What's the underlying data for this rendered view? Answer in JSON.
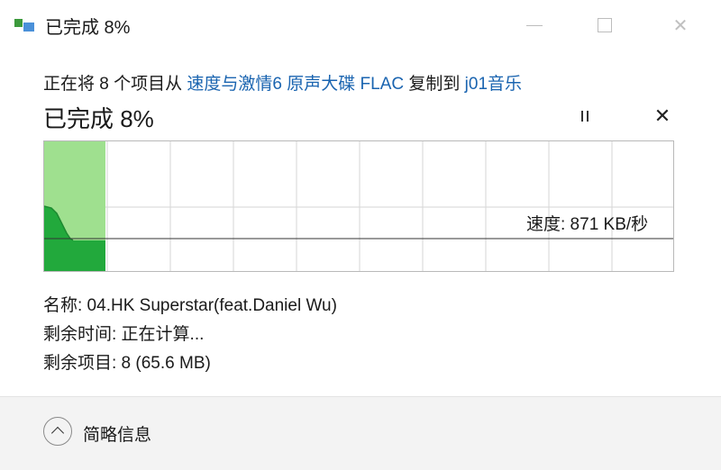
{
  "window": {
    "title": "已完成 8%"
  },
  "copy": {
    "prefix": "正在将 8 个项目从 ",
    "source": "速度与激情6 原声大碟 FLAC",
    "middle": " 复制到 ",
    "destination": "j01音乐"
  },
  "progress": {
    "heading": "已完成 8%",
    "percent": 8,
    "speed_label": "速度: 871 KB/秒"
  },
  "details": {
    "name_label": "名称: 04.HK Superstar(feat.Daniel Wu)",
    "time_label": "剩余时间: 正在计算...",
    "items_label": "剩余项目: 8 (65.6 MB)"
  },
  "footer": {
    "collapse_label": "简略信息"
  },
  "colors": {
    "progress_fill": "#9fe08f",
    "speed_fill": "#22a93c",
    "grid": "#d6d6d6",
    "link": "#1a64b0"
  },
  "icons": {
    "app": "copy-progress-icon",
    "pause": "pause-icon",
    "cancel": "close-icon",
    "collapse": "chevron-up-icon"
  }
}
